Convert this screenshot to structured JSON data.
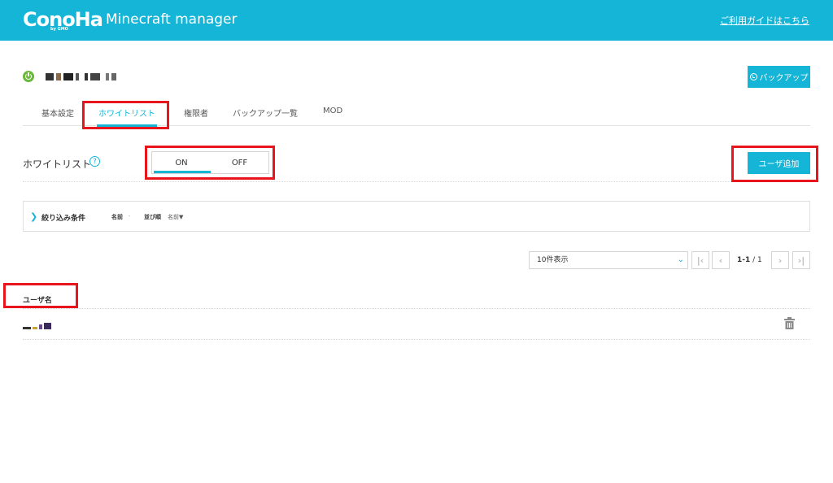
{
  "header": {
    "brand": "ConoHa",
    "brand_sub": "by GMO",
    "product": "Minecraft manager",
    "guide_link": "ご利用ガイドはこちら",
    "bg_color": "#15b5d8"
  },
  "server": {
    "status_icon": "power-icon",
    "status_color": "#6bb93a"
  },
  "backup_button": {
    "label": "バックアップ",
    "icon": "backup-icon"
  },
  "tabs": [
    {
      "label": "基本設定",
      "active": false
    },
    {
      "label": "ホワイトリスト",
      "active": true
    },
    {
      "label": "権限者",
      "active": false
    },
    {
      "label": "バックアップ一覧",
      "active": false
    },
    {
      "label": "MOD",
      "active": false
    }
  ],
  "whitelist": {
    "label": "ホワイトリスト",
    "help_icon": "?",
    "toggle_on": "ON",
    "toggle_off": "OFF",
    "selected": "ON"
  },
  "add_user_button": {
    "label": "ユーザ追加"
  },
  "filter": {
    "chevron": "❯",
    "title": "絞り込み条件",
    "name_label": "名前",
    "name_value": "-",
    "sort_label": "並び順",
    "sort_value": "名前▼"
  },
  "pagination": {
    "per_page": "10件表示",
    "range": "1-1",
    "separator": " / ",
    "total": "1"
  },
  "table": {
    "columns": [
      "ユーザ名"
    ],
    "rows": 1
  },
  "accent_color": "#15b5d8",
  "highlight_color": "#e8161c"
}
